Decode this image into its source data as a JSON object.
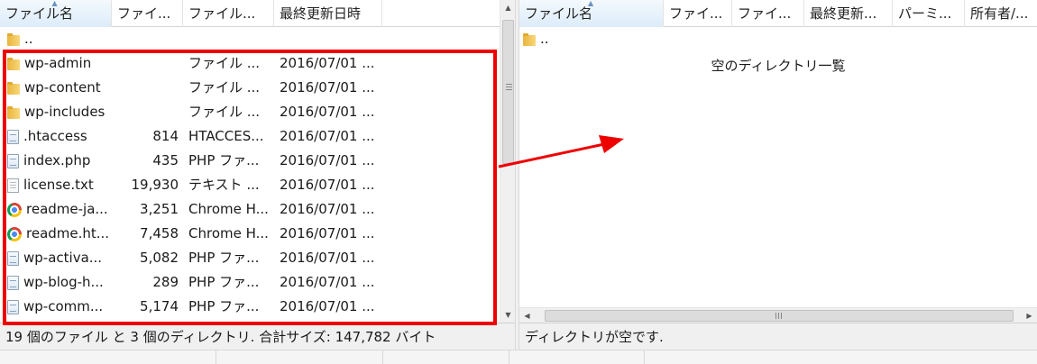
{
  "left_pane": {
    "columns": [
      "ファイル名",
      "ファイ...",
      "ファイル...",
      "最終更新日時"
    ],
    "rows": [
      {
        "icon": "folder",
        "name": "..",
        "size": "",
        "type": "",
        "date": ""
      },
      {
        "icon": "folder",
        "name": "wp-admin",
        "size": "",
        "type": "ファイル ...",
        "date": "2016/07/01 ..."
      },
      {
        "icon": "folder",
        "name": "wp-content",
        "size": "",
        "type": "ファイル ...",
        "date": "2016/07/01 ..."
      },
      {
        "icon": "folder",
        "name": "wp-includes",
        "size": "",
        "type": "ファイル ...",
        "date": "2016/07/01 ..."
      },
      {
        "icon": "file",
        "name": ".htaccess",
        "size": "814",
        "type": "HTACCES...",
        "date": "2016/07/01 ..."
      },
      {
        "icon": "file",
        "name": "index.php",
        "size": "435",
        "type": "PHP ファ...",
        "date": "2016/07/01 ..."
      },
      {
        "icon": "text",
        "name": "license.txt",
        "size": "19,930",
        "type": "テキスト ...",
        "date": "2016/07/01 ..."
      },
      {
        "icon": "chrome",
        "name": "readme-ja...",
        "size": "3,251",
        "type": "Chrome H...",
        "date": "2016/07/01 ..."
      },
      {
        "icon": "chrome",
        "name": "readme.ht...",
        "size": "7,458",
        "type": "Chrome H...",
        "date": "2016/07/01 ..."
      },
      {
        "icon": "file",
        "name": "wp-activa...",
        "size": "5,082",
        "type": "PHP ファ...",
        "date": "2016/07/01 ..."
      },
      {
        "icon": "file",
        "name": "wp-blog-h...",
        "size": "289",
        "type": "PHP ファ...",
        "date": "2016/07/01 ..."
      },
      {
        "icon": "file",
        "name": "wp-comm...",
        "size": "5,174",
        "type": "PHP ファ...",
        "date": "2016/07/01 ..."
      }
    ],
    "status": "19 個のファイル と 3 個のディレクトリ. 合計サイズ: 147,782 バイト"
  },
  "right_pane": {
    "columns": [
      "ファイル名",
      "ファイ...",
      "ファイ...",
      "最終更新...",
      "パーミ...",
      "所有者/..."
    ],
    "parent_row": "..",
    "empty_message": "空のディレクトリ一覧",
    "status": "ディレクトリが空です."
  },
  "colors": {
    "highlight": "#ee0000",
    "arrow": "#ee0000"
  }
}
